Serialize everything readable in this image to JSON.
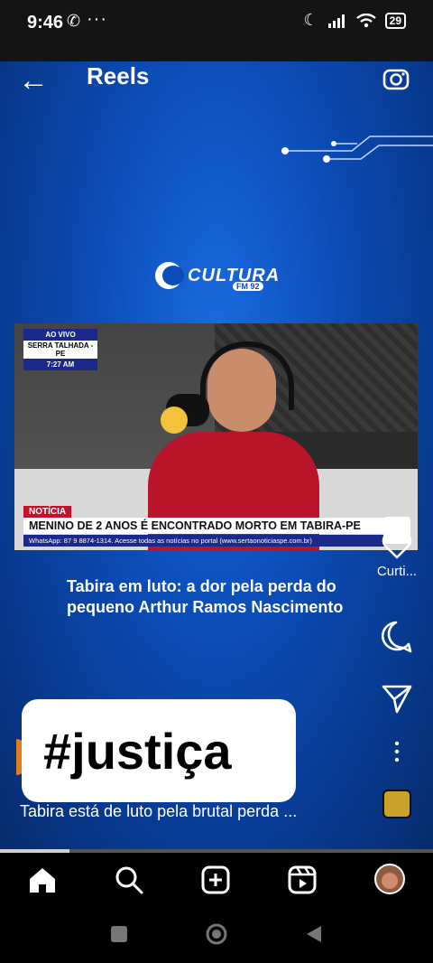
{
  "status": {
    "time": "9:46",
    "battery": "29"
  },
  "header": {
    "title": "Reels"
  },
  "video": {
    "logo_text": "CULTURA",
    "logo_sub": "FM 92",
    "live": {
      "line1": "AO VIVO",
      "line2": "SERRA TALHADA - PE",
      "line3": "7:27 AM"
    },
    "tag": "NOTÍCIA",
    "headline": "MENINO DE 2 ANOS É ENCONTRADO MORTO EM TABIRA-PE",
    "ticker": "WhatsApp: 87 9 8874-1314. Acesse todas as notícias no portal (www.sertaonoticiaspe.com.br)"
  },
  "caption_title": "Tabira em luto: a dor pela perda do pequeno Arthur Ramos Nascimento",
  "actions": {
    "like_label": "Curti..."
  },
  "hashtag": "#justiça",
  "description": "Tabira está de luto pela brutal perda ...",
  "progress": 0.16,
  "icons": [
    "back-arrow-icon",
    "camera-icon",
    "heart-icon",
    "comment-icon",
    "share-icon",
    "more-icon",
    "music-icon",
    "home-icon",
    "search-icon",
    "add-icon",
    "reels-icon"
  ]
}
